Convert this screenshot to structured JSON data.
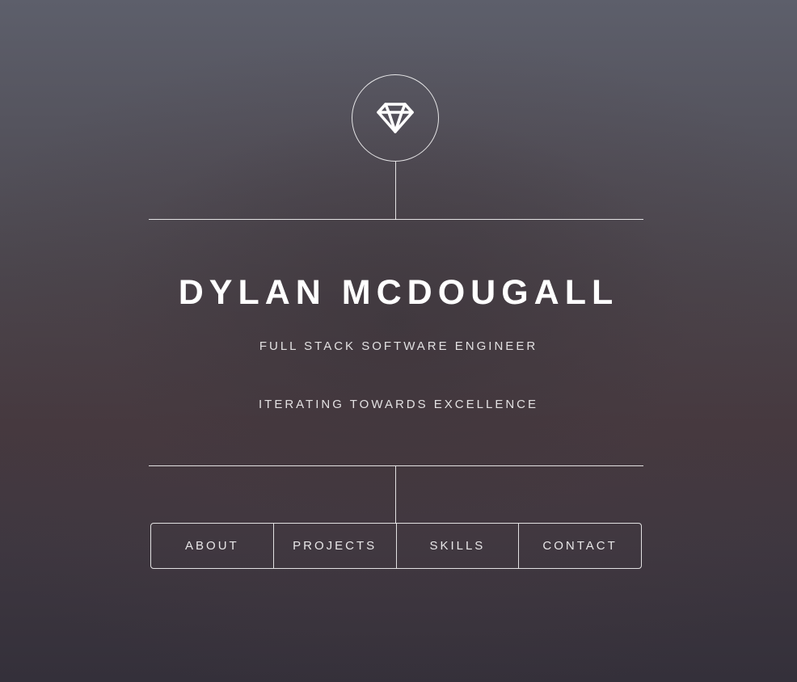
{
  "header": {
    "emblem_icon": "diamond-icon"
  },
  "hero": {
    "name": "DYLAN MCDOUGALL",
    "role": "FULL STACK SOFTWARE ENGINEER",
    "tagline": "ITERATING TOWARDS EXCELLENCE"
  },
  "nav": {
    "items": [
      {
        "label": "ABOUT"
      },
      {
        "label": "PROJECTS"
      },
      {
        "label": "SKILLS"
      },
      {
        "label": "CONTACT"
      }
    ]
  },
  "colors": {
    "foreground": "#ffffff",
    "background_top": "#5d5f6b",
    "background_bottom": "#34303a"
  }
}
